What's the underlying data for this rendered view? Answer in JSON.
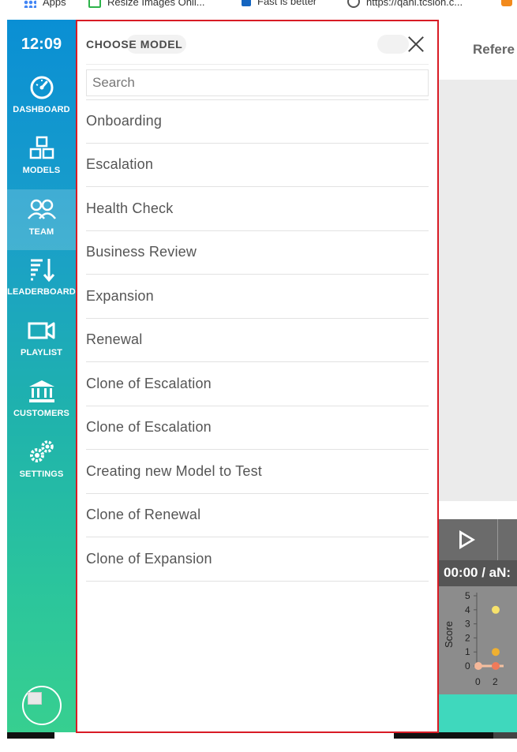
{
  "bookmarks": [
    {
      "label": "Apps",
      "icon": "apps-grid-icon"
    },
    {
      "label": "Resize Images Onli...",
      "icon": "resize-icon"
    },
    {
      "label": "Fast is better",
      "icon": "flag-icon"
    },
    {
      "label": "https://qani.tcsion.c...",
      "icon": "globe-icon"
    }
  ],
  "sidebar": {
    "time": "12:09",
    "items": [
      {
        "label": "DASHBOARD",
        "icon": "dashboard-gauge-icon",
        "active": false
      },
      {
        "label": "MODELS",
        "icon": "cubes-icon",
        "active": false
      },
      {
        "label": "TEAM",
        "icon": "team-icon",
        "active": true
      },
      {
        "label": "LEADERBOARD",
        "icon": "leaderboard-sort-icon",
        "active": false
      },
      {
        "label": "PLAYLIST",
        "icon": "video-camera-icon",
        "active": false
      },
      {
        "label": "CUSTOMERS",
        "icon": "bank-icon",
        "active": false
      },
      {
        "label": "SETTINGS",
        "icon": "gears-icon",
        "active": false
      }
    ],
    "colors": {
      "top": "#0a8fd4",
      "bottom": "#37cf90"
    }
  },
  "modal": {
    "title": "CHOOSE MODEL",
    "search_placeholder": "Search",
    "search_value": "",
    "items": [
      "Onboarding",
      "Escalation",
      "Health Check",
      "Business Review",
      "Expansion",
      "Renewal",
      "Clone of Escalation",
      "Clone of Escalation",
      "Creating new Model to Test",
      "Clone of Renewal",
      "Clone of Expansion"
    ],
    "border_color": "#d81b25"
  },
  "background": {
    "header_text": "Refere",
    "time_display": "00:00 / aN:",
    "chart": {
      "ylabel": "Score",
      "yticks": [
        "5",
        "4",
        "3",
        "2",
        "1",
        "0"
      ],
      "xticks": [
        "0",
        "2"
      ]
    }
  },
  "chart_data": {
    "type": "scatter",
    "title": "",
    "xlabel": "",
    "ylabel": "Score",
    "ylim": [
      0,
      5
    ],
    "series": [
      {
        "x": [
          0,
          2,
          2,
          2
        ],
        "values": [
          0,
          4,
          1,
          0
        ]
      }
    ]
  }
}
